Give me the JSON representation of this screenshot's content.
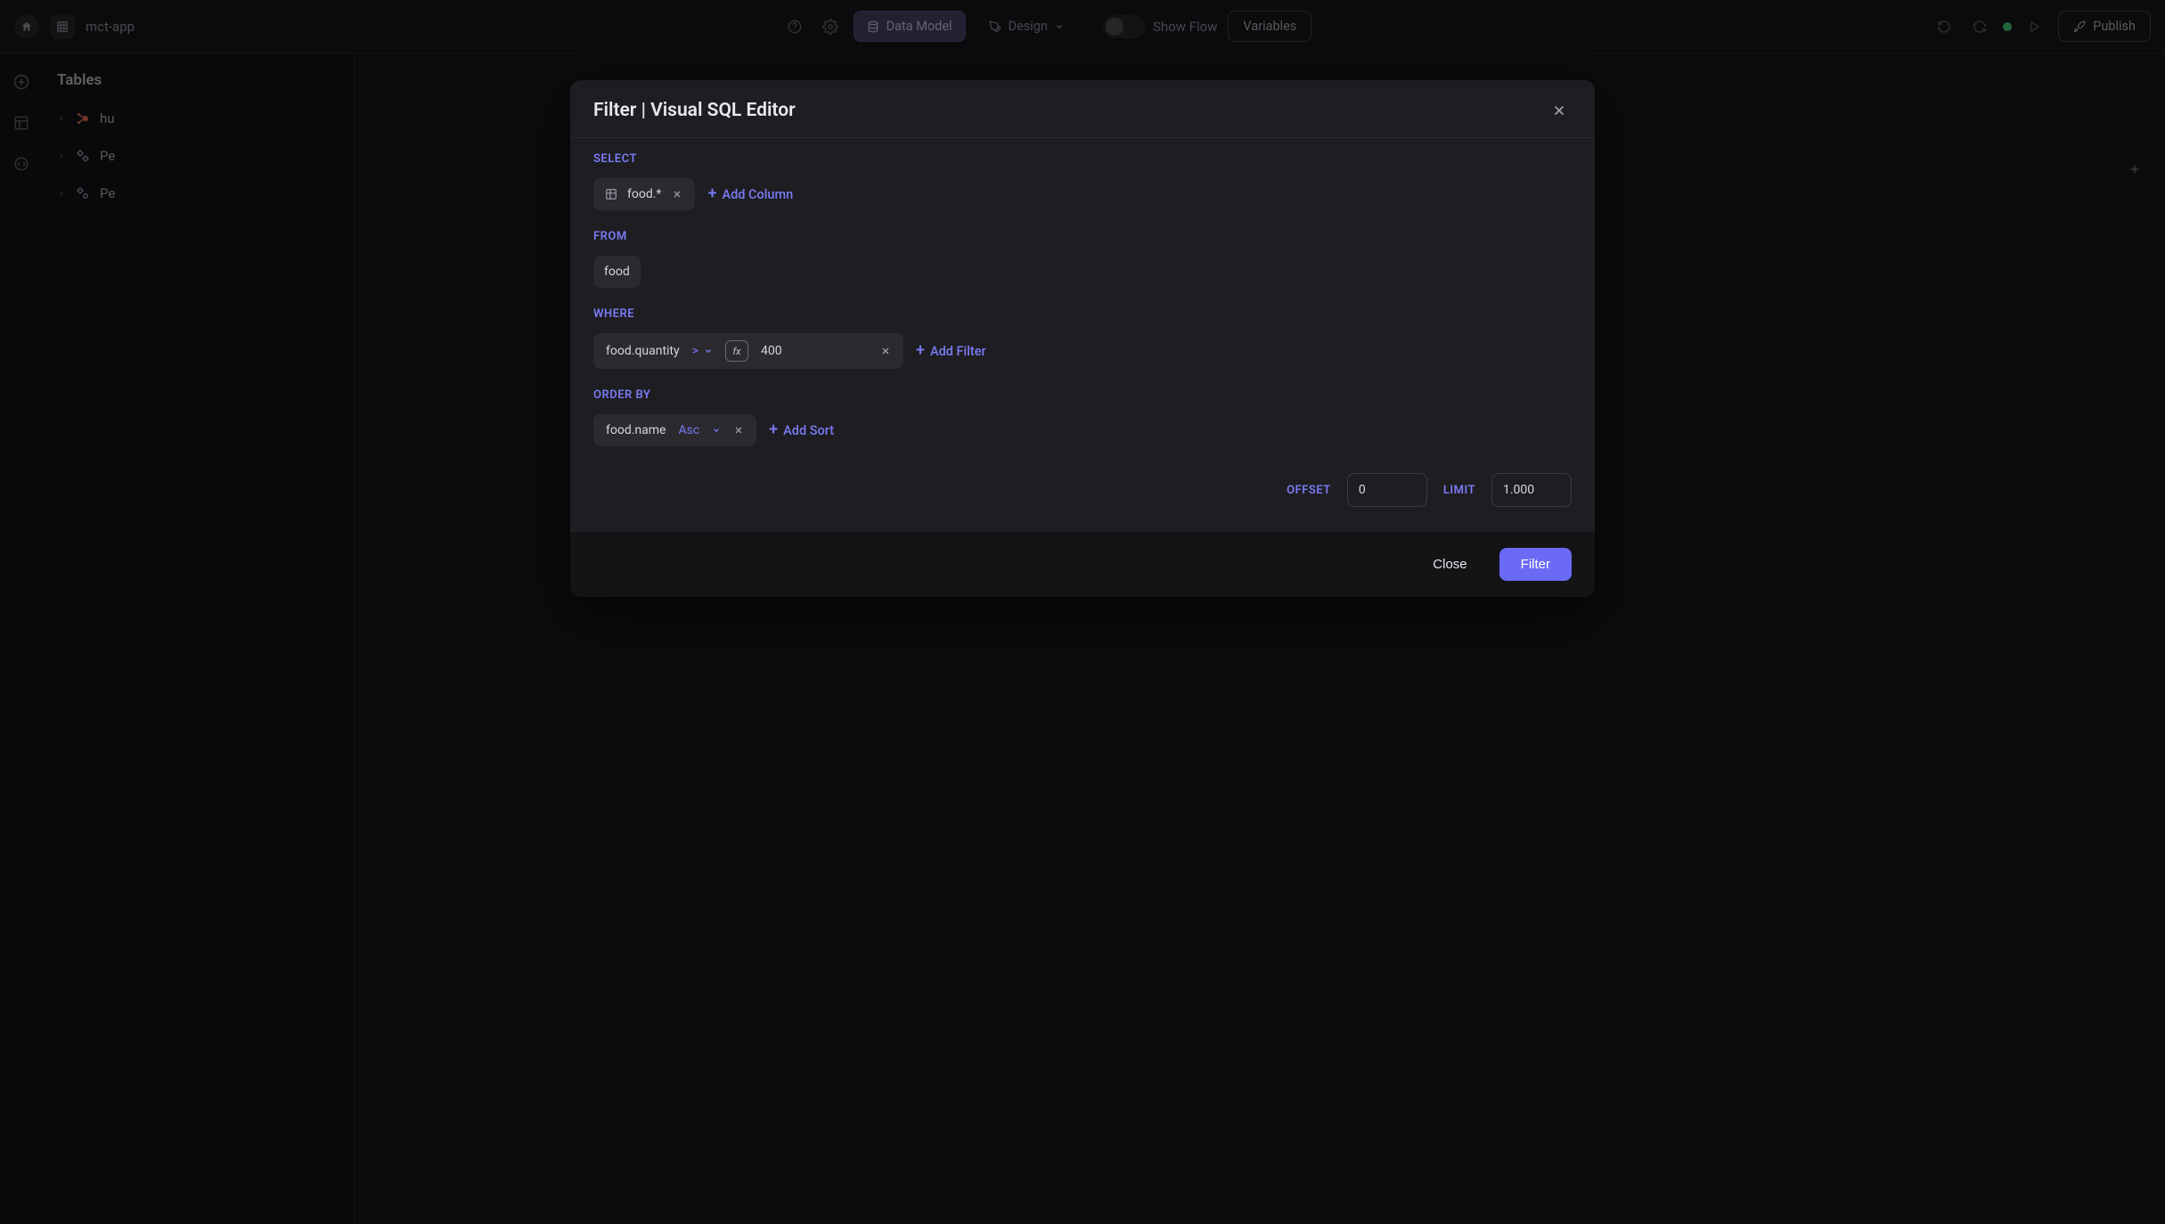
{
  "header": {
    "app_name": "mct-app",
    "mode_data_model": "Data Model",
    "mode_design": "Design",
    "show_flow": "Show Flow",
    "variables": "Variables",
    "publish": "Publish"
  },
  "sidebar": {
    "title": "Tables",
    "items": [
      {
        "label": "hu",
        "icon": "hubspot"
      },
      {
        "label": "Pe",
        "icon": "source"
      },
      {
        "label": "Pe",
        "icon": "source-gear"
      }
    ]
  },
  "modal": {
    "title": "Filter | Visual SQL Editor",
    "sections": {
      "select_label": "SELECT",
      "from_label": "FROM",
      "where_label": "WHERE",
      "orderby_label": "ORDER BY",
      "offset_label": "OFFSET",
      "limit_label": "LIMIT"
    },
    "select": {
      "column": "food.*",
      "add_column": "Add Column"
    },
    "from": {
      "table": "food"
    },
    "where": {
      "column": "food.quantity",
      "operator": ">",
      "value": "400",
      "add_filter": "Add Filter"
    },
    "orderby": {
      "column": "food.name",
      "direction": "Asc",
      "add_sort": "Add Sort"
    },
    "pagination": {
      "offset": "0",
      "limit": "1.000"
    },
    "footer": {
      "close": "Close",
      "filter": "Filter"
    }
  }
}
